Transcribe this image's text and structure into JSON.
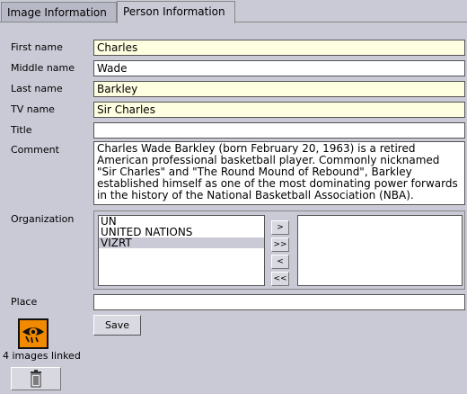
{
  "tabs": [
    {
      "label": "Image Information"
    },
    {
      "label": "Person Information"
    }
  ],
  "form": {
    "first_name": {
      "label": "First name",
      "value": "Charles"
    },
    "middle_name": {
      "label": "Middle name",
      "value": "Wade"
    },
    "last_name": {
      "label": "Last name",
      "value": "Barkley"
    },
    "tv_name": {
      "label": "TV name",
      "value": "Sir Charles"
    },
    "title": {
      "label": "Title",
      "value": ""
    },
    "comment": {
      "label": "Comment",
      "value": "Charles Wade Barkley (born February 20, 1963) is a retired American professional basketball player. Commonly nicknamed \"Sir Charles\" and \"The Round Mound of Rebound\", Barkley established himself as one of the most dominating power forwards in the history of the National Basketball Association (NBA)."
    },
    "organization": {
      "label": "Organization",
      "available": [
        "UN",
        "UNITED NATIONS",
        "VIZRT"
      ],
      "selected_item": "VIZRT",
      "assigned": []
    },
    "place": {
      "label": "Place",
      "value": ""
    },
    "move_buttons": [
      ">",
      ">>",
      "<",
      "<<"
    ],
    "save_label": "Save"
  },
  "images": {
    "linked_text": "4 images linked",
    "icon": "eye-icon",
    "delete_icon": "trash-icon"
  },
  "colors": {
    "background": "#c9cad6",
    "required_field": "#fefee0",
    "eye_button": "#f28a00"
  }
}
